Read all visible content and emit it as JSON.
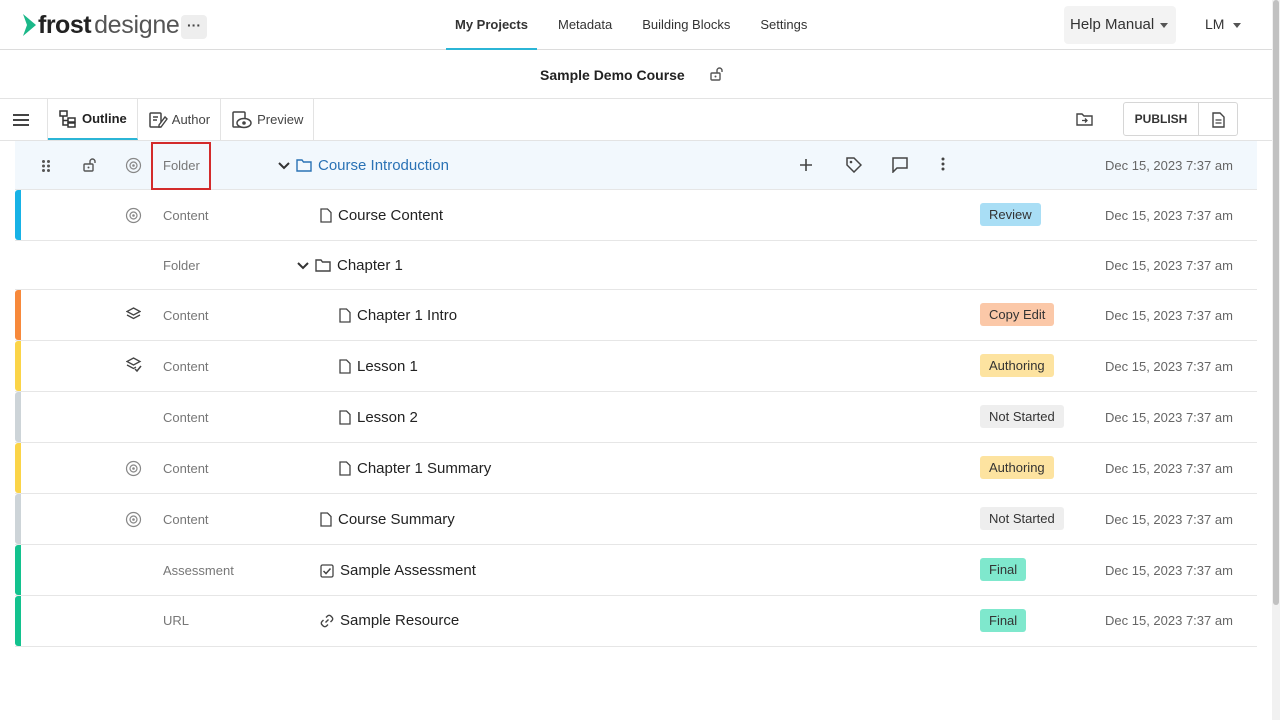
{
  "brand": {
    "name_bold": "frost",
    "name_light": "designer",
    "accent": "#1bb889"
  },
  "topnav": {
    "more_label": "···",
    "items": [
      {
        "label": "My Projects",
        "active": true
      },
      {
        "label": "Metadata"
      },
      {
        "label": "Building Blocks"
      },
      {
        "label": "Settings"
      }
    ],
    "help_label": "Help Manual",
    "user_initials": "LM"
  },
  "course": {
    "title": "Sample Demo Course"
  },
  "toolbar": {
    "tabs": [
      {
        "label": "Outline",
        "active": true
      },
      {
        "label": "Author"
      },
      {
        "label": "Preview"
      }
    ],
    "publish_label": "PUBLISH"
  },
  "rows": [
    {
      "type": "Folder",
      "title": "Course Introduction",
      "date": "Dec 15, 2023 7:37 am",
      "status": "",
      "stripe": "",
      "icon": "folder-icon"
    },
    {
      "type": "Content",
      "title": "Course Content",
      "date": "Dec 15, 2023 7:37 am",
      "status": "Review",
      "status_color": "#a9def5",
      "stripe": "#17b2e6",
      "icon": "document-icon"
    },
    {
      "type": "Folder",
      "title": "Chapter 1",
      "date": "Dec 15, 2023 7:37 am",
      "status": "",
      "stripe": "",
      "icon": "folder-icon"
    },
    {
      "type": "Content",
      "title": "Chapter 1 Intro",
      "date": "Dec 15, 2023 7:37 am",
      "status": "Copy Edit",
      "status_color": "#fbc8a8",
      "stripe": "#f7893b",
      "icon": "document-icon"
    },
    {
      "type": "Content",
      "title": "Lesson 1",
      "date": "Dec 15, 2023 7:37 am",
      "status": "Authoring",
      "status_color": "#fde3a0",
      "stripe": "#fbd448",
      "icon": "document-icon"
    },
    {
      "type": "Content",
      "title": "Lesson 2",
      "date": "Dec 15, 2023 7:37 am",
      "status": "Not Started",
      "status_color": "#eeeeee",
      "stripe": "#cdd4d8",
      "icon": "document-icon"
    },
    {
      "type": "Content",
      "title": "Chapter 1 Summary",
      "date": "Dec 15, 2023 7:37 am",
      "status": "Authoring",
      "status_color": "#fde3a0",
      "stripe": "#fbd448",
      "icon": "document-icon"
    },
    {
      "type": "Content",
      "title": "Course Summary",
      "date": "Dec 15, 2023 7:37 am",
      "status": "Not Started",
      "status_color": "#eeeeee",
      "stripe": "#cdd4d8",
      "icon": "document-icon"
    },
    {
      "type": "Assessment",
      "title": "Sample Assessment",
      "date": "Dec 15, 2023 7:37 am",
      "status": "Final",
      "status_color": "#7fe8cd",
      "stripe": "#13c28e",
      "icon": "checkbox-icon"
    },
    {
      "type": "URL",
      "title": "Sample Resource",
      "date": "Dec 15, 2023 7:37 am",
      "status": "Final",
      "status_color": "#7fe8cd",
      "stripe": "#13c28e",
      "icon": "link-icon"
    }
  ]
}
